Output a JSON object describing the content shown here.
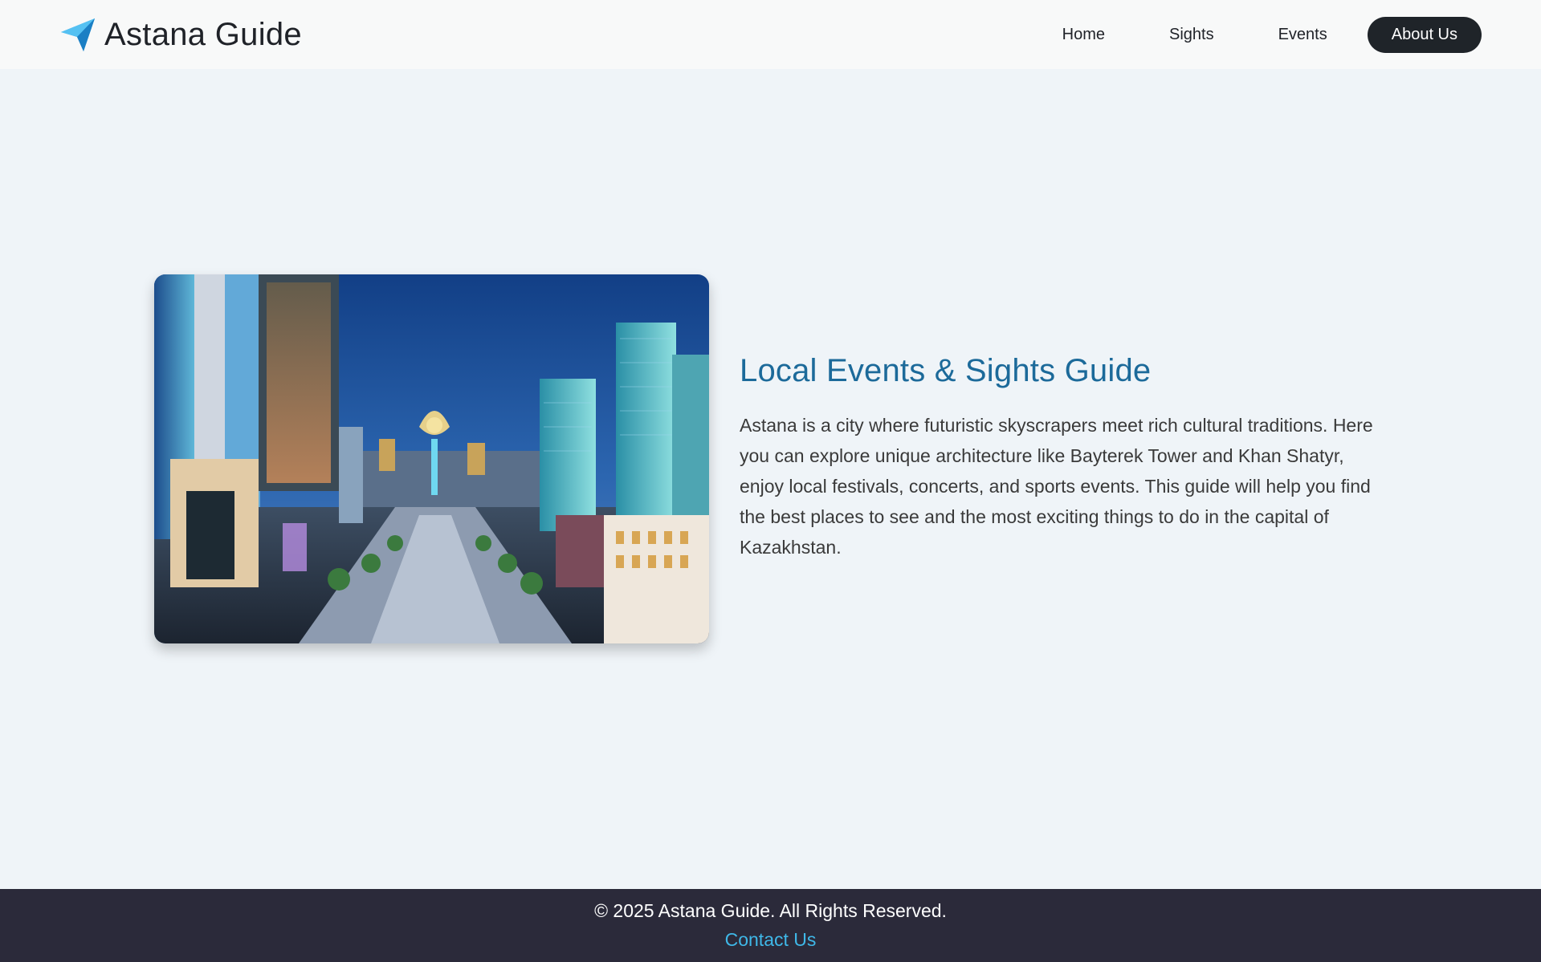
{
  "brand": {
    "name": "Astana Guide",
    "logo_icon": "paper-plane-icon",
    "logo_color": "#2aa3e8"
  },
  "nav": {
    "items": [
      {
        "label": "Home"
      },
      {
        "label": "Sights"
      },
      {
        "label": "Events"
      },
      {
        "label": "About Us",
        "active": true
      }
    ]
  },
  "hero": {
    "image_icon": "city-skyline-photo",
    "title": "Local Events & Sights Guide",
    "body": "Astana is a city where futuristic skyscrapers meet rich cultural traditions. Here you can explore unique architecture like Bayterek Tower and Khan Shatyr, enjoy local festivals, concerts, and sports events. This guide will help you find the best places to see and the most exciting things to do in the capital of Kazakhstan."
  },
  "footer": {
    "copyright": "© 2025 Astana Guide. All Rights Reserved.",
    "contact_label": "Contact Us"
  },
  "colors": {
    "page_bg": "#eff4f8",
    "header_bg": "#f8f9f9",
    "active_nav_bg": "#1f2429",
    "title": "#1c6a9a",
    "footer_bg": "#2b2a3a",
    "link": "#3fb8e8"
  }
}
